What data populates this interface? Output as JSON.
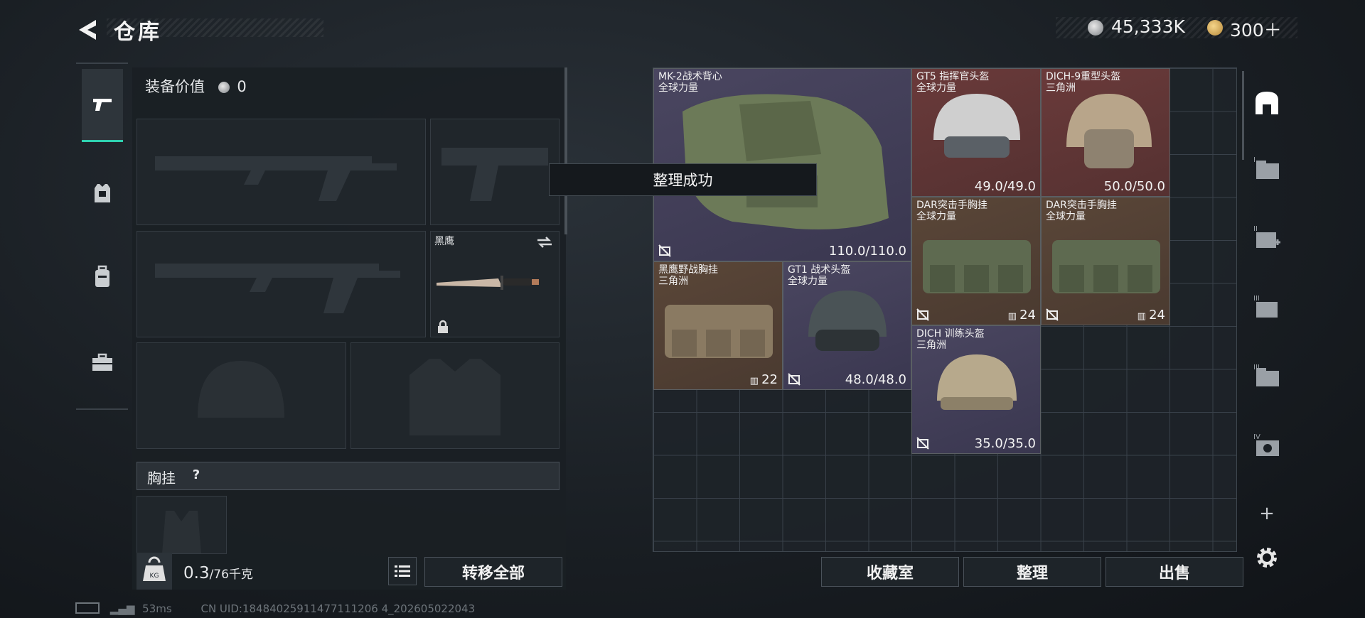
{
  "header": {
    "title": "仓库",
    "back_icon": "back-arrow-icon"
  },
  "currency": {
    "coins": "45,333K",
    "tokens": "300＋",
    "coin_icon": "silver-coin-icon",
    "token_icon": "gold-token-icon"
  },
  "side_tabs": [
    {
      "icon": "pistol-icon",
      "active": true
    },
    {
      "icon": "armor-icon",
      "active": false
    },
    {
      "icon": "backpack-icon",
      "active": false
    },
    {
      "icon": "toolbox-icon",
      "active": false
    }
  ],
  "loadout": {
    "value_label": "装备价值",
    "value": "0",
    "knife_name": "黑鹰",
    "chest_rig_header": "胸挂",
    "help": "?",
    "weight_value": "0.3",
    "weight_unit": "/76千克",
    "kg_icon_label": "KG",
    "transfer_all": "转移全部"
  },
  "stash_items": [
    {
      "name": "MK-2战术背心",
      "faction": "全球力量",
      "durability": "110.0/110.0",
      "rarity": "purple"
    },
    {
      "name": "GT5 指挥官头盔",
      "faction": "全球力量",
      "durability": "49.0/49.0",
      "rarity": "red"
    },
    {
      "name": "DICH-9重型头盔",
      "faction": "三角洲",
      "durability": "50.0/50.0",
      "rarity": "red"
    },
    {
      "name": "DAR突击手胸挂",
      "faction": "全球力量",
      "count": "24",
      "rarity": "brown"
    },
    {
      "name": "DAR突击手胸挂",
      "faction": "全球力量",
      "count": "24",
      "rarity": "brown"
    },
    {
      "name": "黑鹰野战胸挂",
      "faction": "三角洲",
      "count": "22",
      "rarity": "brown"
    },
    {
      "name": "GT1 战术头盔",
      "faction": "全球力量",
      "durability": "48.0/48.0",
      "rarity": "purple"
    },
    {
      "name": "DICH 训练头盔",
      "faction": "三角洲",
      "durability": "35.0/35.0",
      "rarity": "purple"
    }
  ],
  "toast": "整理成功",
  "actions": {
    "collection": "收藏室",
    "sort": "整理",
    "sell": "出售"
  },
  "right_rail": [
    {
      "icon": "stash-home-icon",
      "label": ""
    },
    {
      "icon": "storage-1-icon",
      "label": "I"
    },
    {
      "icon": "storage-2-icon",
      "label": "II"
    },
    {
      "icon": "storage-3-icon",
      "label": "III"
    },
    {
      "icon": "storage-4-icon",
      "label": "III"
    },
    {
      "icon": "storage-5-icon",
      "label": "IV"
    },
    {
      "icon": "add-icon",
      "label": "+"
    },
    {
      "icon": "settings-icon",
      "label": ""
    }
  ],
  "status_bar": {
    "ping": "53ms",
    "uid": "CN UID:18484025911477111206 4_202605022043"
  },
  "colors": {
    "accent": "#2fd1b0",
    "purple": "#4a4660",
    "red": "#6a3a3a",
    "brown": "#5a4638"
  }
}
